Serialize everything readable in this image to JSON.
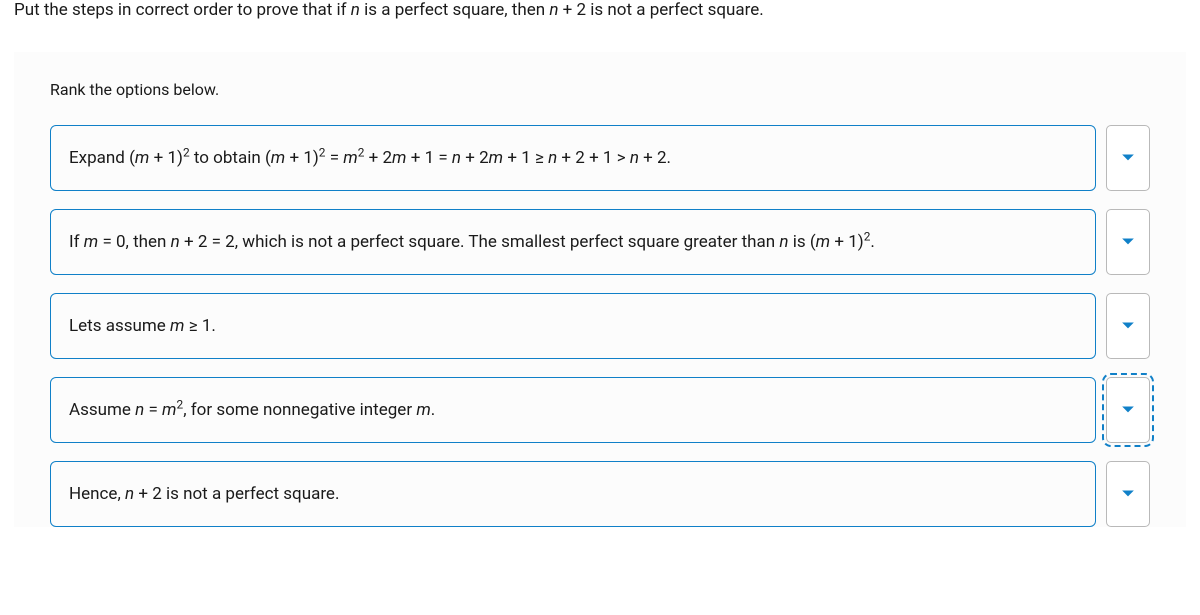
{
  "prompt": {
    "pre": "Put the steps in correct order to prove that if ",
    "nvar": "n",
    "mid1": " is a perfect square, then ",
    "nvar2": "n",
    "plus2": " + 2 is not a perfect square."
  },
  "instruction": "Rank the options below.",
  "options": [
    {
      "parts": [
        {
          "t": "Expand (",
          "i": false
        },
        {
          "t": "m",
          "i": true
        },
        {
          "t": " + 1)",
          "i": false
        },
        {
          "t": "2",
          "sup": true
        },
        {
          "t": " to obtain (",
          "i": false
        },
        {
          "t": "m",
          "i": true
        },
        {
          "t": " + 1)",
          "i": false
        },
        {
          "t": "2",
          "sup": true
        },
        {
          "t": " = ",
          "i": false
        },
        {
          "t": "m",
          "i": true
        },
        {
          "t": "2",
          "sup": true
        },
        {
          "t": " + 2",
          "i": false
        },
        {
          "t": "m",
          "i": true
        },
        {
          "t": " + 1 = ",
          "i": false
        },
        {
          "t": "n",
          "i": true
        },
        {
          "t": " + 2",
          "i": false
        },
        {
          "t": "m",
          "i": true
        },
        {
          "t": " + 1 ≥ ",
          "i": false
        },
        {
          "t": "n",
          "i": true
        },
        {
          "t": " + 2 + 1 > ",
          "i": false
        },
        {
          "t": "n",
          "i": true
        },
        {
          "t": " + 2.",
          "i": false
        }
      ],
      "focused": false
    },
    {
      "parts": [
        {
          "t": "If ",
          "i": false
        },
        {
          "t": "m",
          "i": true
        },
        {
          "t": " = 0, then ",
          "i": false
        },
        {
          "t": "n",
          "i": true
        },
        {
          "t": " + 2 = 2, which is not a perfect square. The smallest perfect square greater than ",
          "i": false
        },
        {
          "t": "n",
          "i": true
        },
        {
          "t": " is (",
          "i": false
        },
        {
          "t": "m",
          "i": true
        },
        {
          "t": " + 1)",
          "i": false
        },
        {
          "t": "2",
          "sup": true
        },
        {
          "t": ".",
          "i": false
        }
      ],
      "focused": false
    },
    {
      "parts": [
        {
          "t": "Lets assume ",
          "i": false
        },
        {
          "t": "m",
          "i": true
        },
        {
          "t": " ≥ 1.",
          "i": false
        }
      ],
      "focused": false
    },
    {
      "parts": [
        {
          "t": "Assume ",
          "i": false
        },
        {
          "t": "n",
          "i": true
        },
        {
          "t": " = ",
          "i": false
        },
        {
          "t": "m",
          "i": true
        },
        {
          "t": "2",
          "sup": true
        },
        {
          "t": ", for some nonnegative integer ",
          "i": false
        },
        {
          "t": "m",
          "i": true
        },
        {
          "t": ".",
          "i": false
        }
      ],
      "focused": true
    },
    {
      "parts": [
        {
          "t": "Hence, ",
          "i": false
        },
        {
          "t": "n",
          "i": true
        },
        {
          "t": " + 2 is not a perfect square.",
          "i": false
        }
      ],
      "focused": false
    }
  ]
}
